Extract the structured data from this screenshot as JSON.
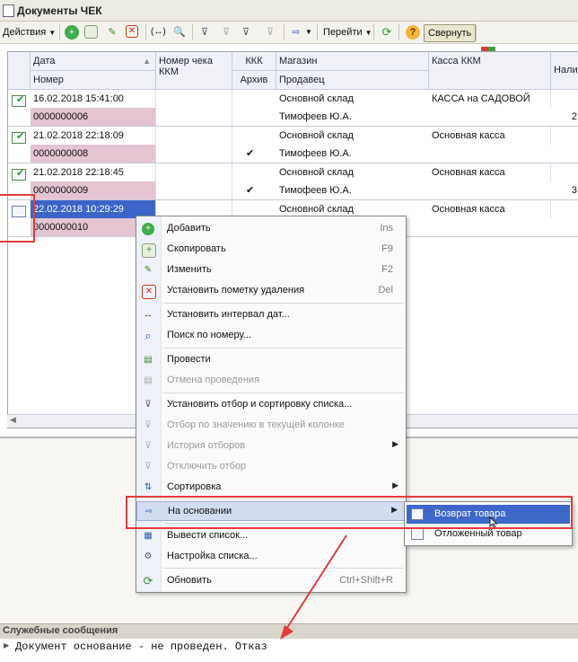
{
  "window": {
    "title": "Документы ЧЕК"
  },
  "toolbar": {
    "actions_label": "Действия",
    "goto_label": "Перейти",
    "collapse_label": "Свернуть"
  },
  "table": {
    "headers": {
      "date": "Дата",
      "number": "Номер",
      "kkm_check_no": "Номер чека ККМ",
      "kkk": "ККК",
      "archive": "Архив",
      "store": "Магазин",
      "seller": "Продавец",
      "kkm_cash": "Касса ККМ",
      "cash_trunc": "Нали"
    },
    "rows": [
      {
        "date": "16.02.2018 15:41:00",
        "number": "0000000006",
        "archive": "",
        "store": "Основной склад",
        "seller": "Тимофеев Ю.А.",
        "cash": "КАССА на САДОВОЙ",
        "extra": "2"
      },
      {
        "date": "21.02.2018 22:18:09",
        "number": "0000000008",
        "archive": "✔",
        "store": "Основной склад",
        "seller": "Тимофеев Ю.А.",
        "cash": "Основная касса",
        "extra": ""
      },
      {
        "date": "21.02.2018 22:18:45",
        "number": "0000000009",
        "archive": "✔",
        "store": "Основной склад",
        "seller": "Тимофеев Ю.А.",
        "cash": "Основная касса",
        "extra": "3"
      },
      {
        "date": "22.02.2018 10:29:29",
        "number": "0000000010",
        "archive": "",
        "store": "Основной склад",
        "seller": "",
        "cash": "Основная касса",
        "extra": ""
      }
    ]
  },
  "context_menu": {
    "items": [
      {
        "label": "Добавить",
        "shortcut": "Ins",
        "icon": "add-icon"
      },
      {
        "label": "Скопировать",
        "shortcut": "F9",
        "icon": "copy-icon"
      },
      {
        "label": "Изменить",
        "shortcut": "F2",
        "icon": "edit-icon"
      },
      {
        "label": "Установить пометку удаления",
        "shortcut": "Del",
        "icon": "delete-mark-icon"
      },
      {
        "label": "Установить интервал дат...",
        "shortcut": "",
        "icon": "date-interval-icon"
      },
      {
        "label": "Поиск по номеру...",
        "shortcut": "",
        "icon": "search-icon"
      },
      {
        "label": "Провести",
        "shortcut": "",
        "icon": "post-icon"
      },
      {
        "label": "Отмена проведения",
        "shortcut": "",
        "icon": "unpost-icon"
      },
      {
        "label": "Установить отбор и сортировку списка...",
        "shortcut": "",
        "icon": "filter-sort-icon"
      },
      {
        "label": "Отбор по значению в текущей колонке",
        "shortcut": "",
        "icon": "filter-value-icon"
      },
      {
        "label": "История отборов",
        "shortcut": "",
        "icon": "filter-history-icon"
      },
      {
        "label": "Отключить отбор",
        "shortcut": "",
        "icon": "filter-off-icon"
      },
      {
        "label": "Сортировка",
        "shortcut": "",
        "icon": "sort-icon"
      },
      {
        "label": "На основании",
        "shortcut": "",
        "icon": "based-on-icon"
      },
      {
        "label": "Вывести список...",
        "shortcut": "",
        "icon": "export-list-icon"
      },
      {
        "label": "Настройка списка...",
        "shortcut": "",
        "icon": "list-settings-icon"
      },
      {
        "label": "Обновить",
        "shortcut": "Ctrl+Shift+R",
        "icon": "refresh-icon"
      }
    ]
  },
  "submenu": {
    "items": [
      {
        "label": "Возврат товара"
      },
      {
        "label": "Отложенный товар"
      }
    ]
  },
  "messages": {
    "header": "Служебные сообщения",
    "lines": [
      "Документ основание - не проведен. Отказ"
    ]
  }
}
